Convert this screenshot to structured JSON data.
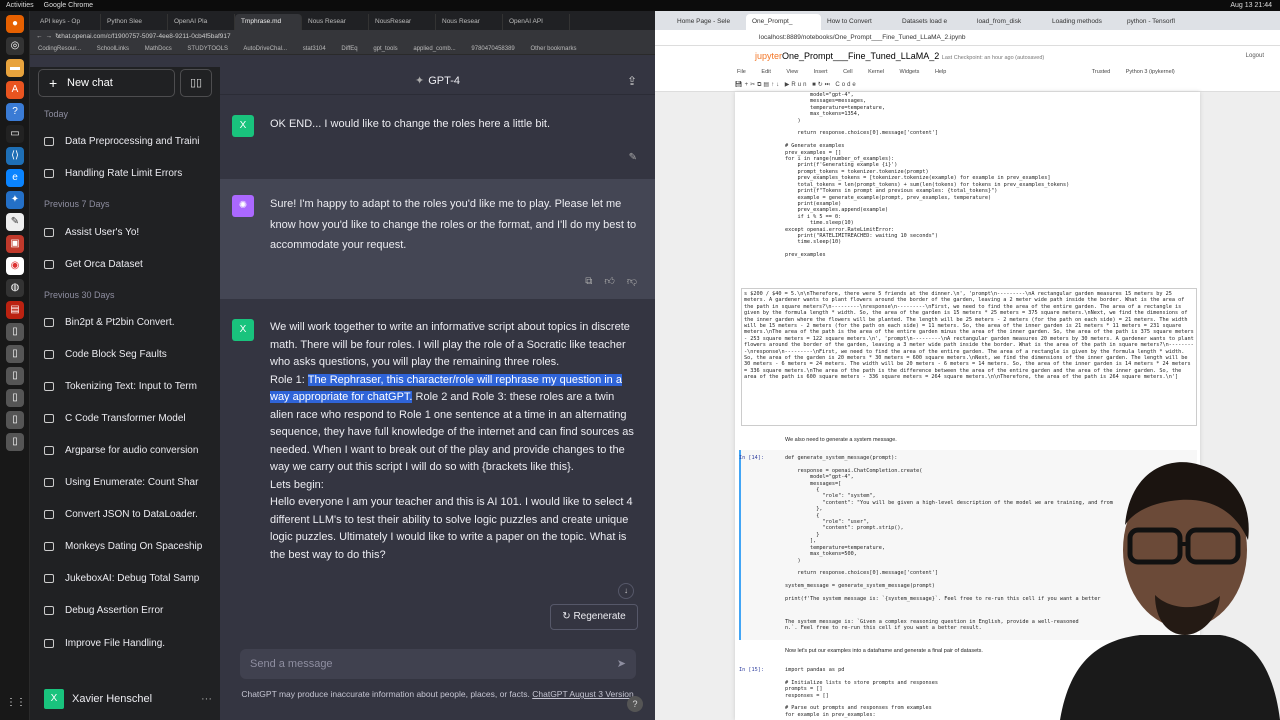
{
  "topbar": {
    "left": [
      "Activities",
      "Google Chrome"
    ],
    "right": "Aug 13  21:44"
  },
  "left_browser": {
    "tabs": [
      "API keys - Op",
      "Python Slee",
      "OpenAI Pla",
      "Tmphrase.md",
      "Nous Resear",
      "NousResear",
      "Nous Resear",
      "OpenAI API"
    ],
    "address": "chat.openai.com/c/f1900757-5097-4ee8-9211-0cb4f5baf917",
    "bookmarks": [
      "CodingResour...",
      "SchoolLinks",
      "MathDocs",
      "STUDYTOOLS",
      "AutoDriveChal...",
      "stat3104",
      "DiffEq",
      "gpt_tools",
      "applied_comb...",
      "9780470458389",
      "Other bookmarks"
    ]
  },
  "sidebar": {
    "new_chat": "New chat",
    "sections": [
      {
        "heading": "Today",
        "items": [
          "Data Preprocessing and Traini",
          "Handling Rate Limit Errors"
        ]
      },
      {
        "heading": "Previous 7 Days",
        "items": [
          "Assist User's Yo!",
          "Get Orca Dataset"
        ]
      },
      {
        "heading": "Previous 30 Days",
        "items": [
          "Bin2pt & Pt2bin Convert.",
          "Code Block Seg Faults",
          "Tokenizing Text: Input to Term",
          "C Code Transformer Model",
          "Argparse for audio conversion",
          "Using Enumerate: Count Shar",
          "Convert JSON to DataLoader.",
          "Monkeys Dating On Spaceship",
          "JukeboxAI: Debug Total Samp",
          "Debug Assertion Error",
          "Improve File Handling."
        ]
      }
    ],
    "user": {
      "initial": "X",
      "name": "Xavier Henschel"
    }
  },
  "chat": {
    "model": "GPT-4",
    "messages": [
      {
        "role": "user",
        "initial": "X",
        "text": "OK END... I would like to change the roles here a little bit."
      },
      {
        "role": "assistant",
        "text": "Sure! I'm happy to adapt to the roles you'd like me to play. Please let me know how you'd like to change the roles or the format, and I'll do my best to accommodate your request."
      },
      {
        "role": "user",
        "initial": "X",
        "p1": "We will work together to write an informative script about topics in discrete math. There will be four roles. I will play the role of a Socratic like teacher who asks questions, you will play the remaining three roles.",
        "p2_prefix": "Role 1: ",
        "p2_highlight": "The Rephraser, this character/role will rephrase my question in a way appropriate for chatGPT.",
        "p2_rest": " Role 2 and Role 3: these roles are a twin alien race who respond to Role 1 one sentence at a time in an alternating sequence, they have full knowledge of the internet and can find sources as needed. When I want to break out of the play and provide changes to the way we carry out this script I will do so with {brackets like this}.",
        "p3": "Lets begin:",
        "p4": "Hello everyone I am your teacher and this is AI 101. I would like to select 4 different LLM's to test their ability to solve logic puzzles and create unique logic puzzles. Ultimately I would like to write a paper on the topic. What is the best way to do this?"
      }
    ],
    "regenerate": "Regenerate",
    "input_placeholder": "Send a message",
    "footer_text": "ChatGPT may produce inaccurate information about people, places, or facts.",
    "footer_link": "ChatGPT August 3 Version"
  },
  "right_browser": {
    "tabs": [
      "Home Page - Sele",
      "One_Prompt_",
      "How to Convert",
      "Datasets load e",
      "load_from_disk",
      "Loading methods",
      "python - Tensorfl"
    ],
    "address": "localhost:8889/notebooks/One_Prompt___Fine_Tuned_LLaMA_2.ipynb",
    "jupyter_logo": "jupyter",
    "notebook_title": "One_Prompt___Fine_Tuned_LLaMA_2",
    "checkpoint": "Last Checkpoint: an hour ago  (autosaved)",
    "logout": "Logout",
    "kernel": "Python 3 (ipykernel)",
    "trusted": "Trusted",
    "menu": [
      "File",
      "Edit",
      "View",
      "Insert",
      "Cell",
      "Kernel",
      "Widgets",
      "Help"
    ],
    "toolbar": "Run",
    "cell_type": "Code",
    "prompt14": "In [14]:",
    "prompt15": "In [15]:",
    "md1": "We also need to generate a system message.",
    "md2": "Now let's put our examples into a dataframe and generate a final pair of datasets.",
    "code1": "        model=\"gpt-4\",\n        messages=messages,\n        temperature=temperature,\n        max_tokens=1354,\n    )\n\n    return response.choices[0].message['content']\n\n# Generate examples\nprev_examples = []\nfor i in range(number_of_examples):\n    print(f'Generating example {i}')\n    prompt_tokens = tokenizer.tokenize(prompt)\n    prev_examples_tokens = [tokenizer.tokenize(example) for example in prev_examples]\n    total_tokens = len(prompt_tokens) + sum(len(tokens) for tokens in prev_examples_tokens)\n    print(f\"Tokens in prompt and previous examples: {total_tokens}\")\n    example = generate_example(prompt, prev_examples, temperature)\n    print(example)\n    prev_examples.append(example)\n    if i % 5 == 0:\n        time.sleep(10)\nexcept openai.error.RateLimitError:\n    print(\"RATELIMITREACHED: waiting 10 seconds\")\n    time.sleep(10)\n\nprev_examples",
    "output": "s $200 / $40 = 5.\\n\\nTherefore, there were 5 friends at the dinner.\\n', 'prompt\\n---------\\nA rectangular garden measures 15 meters by 25 meters. A gardener wants to plant flowers around the border of the garden, leaving a 2 meter wide path inside the border. What is the area of the path in square meters?\\n---------\\nresponse\\n---------\\nFirst, we need to find the area of the entire garden. The area of a rectangle is given by the formula length * width. So, the area of the garden is 15 meters * 25 meters = 375 square meters.\\nNext, we find the dimensions of the inner garden where the flowers will be planted. The length will be 25 meters - 2 meters (for the path on each side) = 21 meters. The width will be 15 meters - 2 meters (for the path on each side) = 11 meters. So, the area of the inner garden is 21 meters * 11 meters = 231 square meters.\\nThe area of the path is the area of the entire garden minus the area of the inner garden. So, the area of the path is 375 square meters - 253 square meters = 122 square meters.\\n', 'prompt\\n---------\\nA rectangular garden measures 20 meters by 30 meters. A gardener wants to plant flowers around the border of the garden, leaving a 3 meter wide path inside the border. What is the area of the path in square meters?\\n---------\\nresponse\\n---------\\nFirst, we need to find the area of the entire garden. The area of a rectangle is given by the formula length * width. So, the area of the garden is 20 meters * 30 meters = 600 square meters.\\nNext, we find the dimensions of the inner garden. The length will be 30 meters - 6 meters = 24 meters. The width will be 20 meters - 6 meters = 14 meters. So, the area of the inner garden is 14 meters * 24 meters = 336 square meters.\\nThe area of the path is the difference between the area of the entire garden and the area of the inner garden. So, the area of the path is 600 square meters - 336 square meters = 264 square meters.\\n\\nTherefore, the area of the path is 264 square meters.\\n']",
    "code2": "def generate_system_message(prompt):\n\n    response = openai.ChatCompletion.create(\n        model=\"gpt-4\",\n        messages=[\n          {\n            \"role\": \"system\",\n            \"content\": \"You will be given a high-level description of the model we are training, and from\n          },\n          {\n            \"role\": \"user\",\n            \"content\": prompt.strip(),\n          }\n        ],\n        temperature=temperature,\n        max_tokens=500,\n    )\n\n    return response.choices[0].message['content']\n\nsystem_message = generate_system_message(prompt)\n\nprint(f'The system message is: `{system_message}`. Feel free to re-run this cell if you want a better",
    "cell_out2": "The system message is: `Given a complex reasoning question in English, provide a well-reasoned\nn.`. Feel free to re-run this cell if you want a better result.",
    "code3": "import pandas as pd\n\n# Initialize lists to store prompts and responses\nprompts = []\nresponses = []\n\n# Parse out prompts and responses from examples\nfor example in prev_examples:"
  }
}
